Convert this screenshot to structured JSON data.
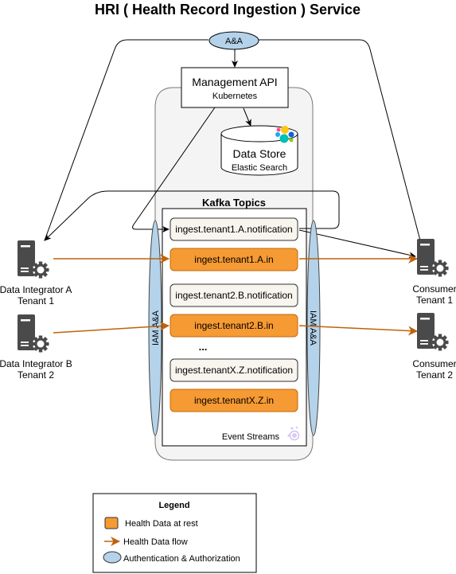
{
  "title": "HRI ( Health Record Ingestion ) Service",
  "colors": {
    "orange": "#f69a33",
    "orange_stroke": "#c06a11",
    "flow_arrow": "#c0620a",
    "auth_fill": "#b4d3ea",
    "notification_fill": "#f8f5ee",
    "container_fill": "#f4f4f4",
    "server_icon": "#4a4a4a"
  },
  "auth_top": {
    "label": "A&A"
  },
  "management_api": {
    "title": "Management API",
    "subtitle": "Kubernetes"
  },
  "data_store": {
    "title": "Data Store",
    "subtitle": "Elastic Search",
    "icon": "elasticsearch-icon"
  },
  "kafka": {
    "title": "Kafka Topics",
    "footer": "Event Streams",
    "footer_icon": "event-streams-icon",
    "ellipsis": "...",
    "topics": [
      {
        "name": "ingest.tenant1.A.notification",
        "type": "notification"
      },
      {
        "name": "ingest.tenant1.A.in",
        "type": "data"
      },
      {
        "name": "ingest.tenant2.B.notification",
        "type": "notification"
      },
      {
        "name": "ingest.tenant2.B.in",
        "type": "data"
      },
      {
        "name": "ingest.tenantX.Z.notification",
        "type": "notification"
      },
      {
        "name": "ingest.tenantX.Z.in",
        "type": "data"
      }
    ]
  },
  "iam_left": {
    "label": "IAM A&A"
  },
  "iam_right": {
    "label": "IAM A&A"
  },
  "producers": [
    {
      "line1": "Data Integrator A",
      "line2": "Tenant 1",
      "icon": "server-gear-icon"
    },
    {
      "line1": "Data Integrator B",
      "line2": "Tenant 2",
      "icon": "server-gear-icon"
    }
  ],
  "consumers": [
    {
      "line1": "Consumer",
      "line2": "Tenant 1",
      "icon": "server-gear-icon"
    },
    {
      "line1": "Consumer",
      "line2": "Tenant 2",
      "icon": "server-gear-icon"
    }
  ],
  "legend": {
    "title": "Legend",
    "items": [
      {
        "label": "Health Data at rest",
        "symbol": "orange-square"
      },
      {
        "label": "Health Data flow",
        "symbol": "orange-arrow"
      },
      {
        "label": "Authentication & Authorization",
        "symbol": "blue-ellipse"
      }
    ]
  }
}
